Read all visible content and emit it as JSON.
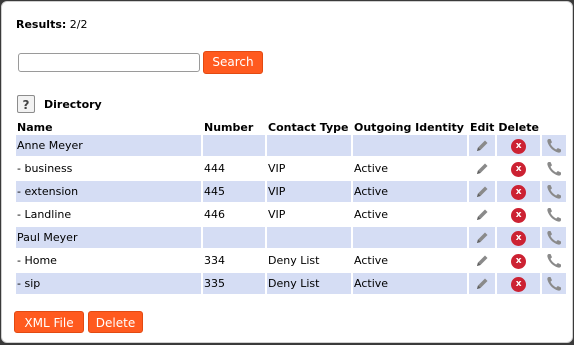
{
  "results": {
    "label": "Results:",
    "value": "2/2"
  },
  "search": {
    "value": "",
    "placeholder": "",
    "button_label": "Search"
  },
  "directory": {
    "help_label": "?",
    "title": "Directory"
  },
  "table": {
    "headers": {
      "name": "Name",
      "number": "Number",
      "contact_type": "Contact Type",
      "outgoing_identity": "Outgoing Identity",
      "edit": "Edit",
      "delete": "Delete"
    },
    "rows": [
      {
        "name": "Anne Meyer",
        "number": "",
        "contact_type": "",
        "outgoing_identity": ""
      },
      {
        "name": "- business",
        "number": "444",
        "contact_type": "VIP",
        "outgoing_identity": "Active"
      },
      {
        "name": "- extension",
        "number": "445",
        "contact_type": "VIP",
        "outgoing_identity": "Active"
      },
      {
        "name": "- Landline",
        "number": "446",
        "contact_type": "VIP",
        "outgoing_identity": "Active"
      },
      {
        "name": "Paul Meyer",
        "number": "",
        "contact_type": "",
        "outgoing_identity": ""
      },
      {
        "name": "- Home",
        "number": "334",
        "contact_type": "Deny List",
        "outgoing_identity": "Active"
      },
      {
        "name": "- sip",
        "number": "335",
        "contact_type": "Deny List",
        "outgoing_identity": "Active"
      }
    ],
    "icons": {
      "edit": "pencil-icon",
      "delete": "delete-x-icon",
      "call": "phone-icon"
    },
    "delete_glyph": "x"
  },
  "footer": {
    "xml_button_label": "XML File",
    "delete_button_label": "Delete"
  },
  "colors": {
    "accent": "#ff5a1f",
    "row_shade": "#d5ddf4",
    "delete_icon": "#cc2233",
    "icon_gray": "#8a8a8a"
  }
}
